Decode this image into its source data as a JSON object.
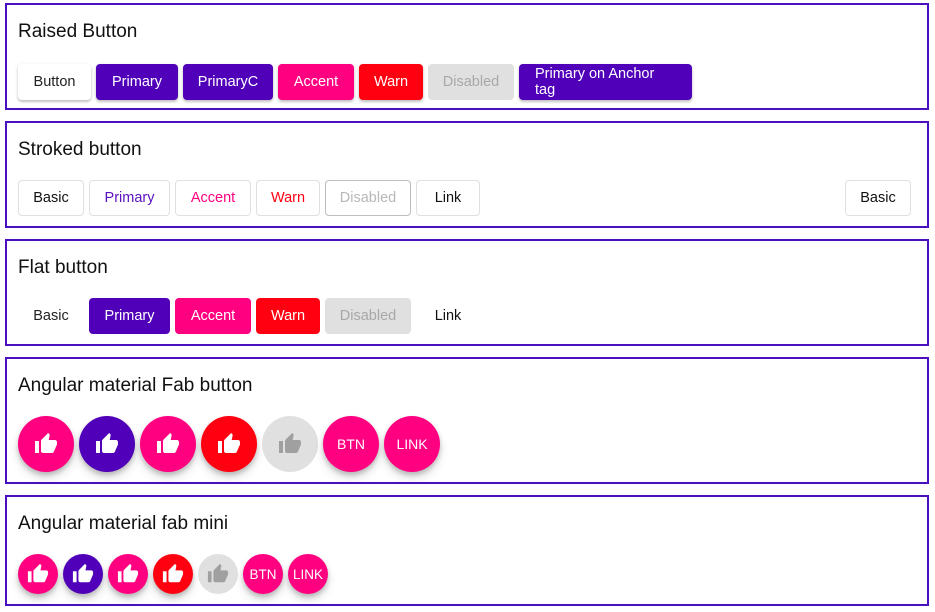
{
  "colors": {
    "primary": "#5000b8",
    "accent": "#ff0080",
    "warn": "#ff0010",
    "disabled_bg": "#e0e0e0",
    "panel_border": "#4a10c0"
  },
  "raised": {
    "title": "Raised Button",
    "buttons": [
      {
        "label": "Button",
        "color": "basic"
      },
      {
        "label": "Primary",
        "color": "primary"
      },
      {
        "label": "PrimaryC",
        "color": "primary"
      },
      {
        "label": "Accent",
        "color": "accent"
      },
      {
        "label": "Warn",
        "color": "warn"
      },
      {
        "label": "Disabled",
        "color": "disabled"
      },
      {
        "label": "Primary on Anchor tag",
        "color": "primary"
      }
    ]
  },
  "stroked": {
    "title": "Stroked button",
    "buttons": [
      {
        "label": "Basic",
        "color": "basic"
      },
      {
        "label": "Primary",
        "color": "primary"
      },
      {
        "label": "Accent",
        "color": "accent"
      },
      {
        "label": "Warn",
        "color": "warn"
      },
      {
        "label": "Disabled",
        "color": "disabled"
      },
      {
        "label": "Link",
        "color": "basic"
      }
    ],
    "right_button": {
      "label": "Basic",
      "color": "basic"
    }
  },
  "flat": {
    "title": "Flat button",
    "buttons": [
      {
        "label": "Basic",
        "color": "basic"
      },
      {
        "label": "Primary",
        "color": "primary"
      },
      {
        "label": "Accent",
        "color": "accent"
      },
      {
        "label": "Warn",
        "color": "warn"
      },
      {
        "label": "Disabled",
        "color": "disabled"
      },
      {
        "label": "Link",
        "color": "basic"
      }
    ]
  },
  "fab": {
    "title": "Angular material Fab button",
    "buttons": [
      {
        "icon": "thumb-up-icon",
        "color": "accent"
      },
      {
        "icon": "thumb-up-icon",
        "color": "primary"
      },
      {
        "icon": "thumb-up-icon",
        "color": "accent"
      },
      {
        "icon": "thumb-up-icon",
        "color": "warn"
      },
      {
        "icon": "thumb-up-icon",
        "color": "disabled"
      },
      {
        "label": "BTN",
        "color": "accent"
      },
      {
        "label": "LINK",
        "color": "accent"
      }
    ]
  },
  "fab_mini": {
    "title": "Angular material fab mini",
    "buttons": [
      {
        "icon": "thumb-up-icon",
        "color": "accent"
      },
      {
        "icon": "thumb-up-icon",
        "color": "primary"
      },
      {
        "icon": "thumb-up-icon",
        "color": "accent"
      },
      {
        "icon": "thumb-up-icon",
        "color": "warn"
      },
      {
        "icon": "thumb-up-icon",
        "color": "disabled"
      },
      {
        "label": "BTN",
        "color": "accent"
      },
      {
        "label": "LINK",
        "color": "accent"
      }
    ]
  }
}
